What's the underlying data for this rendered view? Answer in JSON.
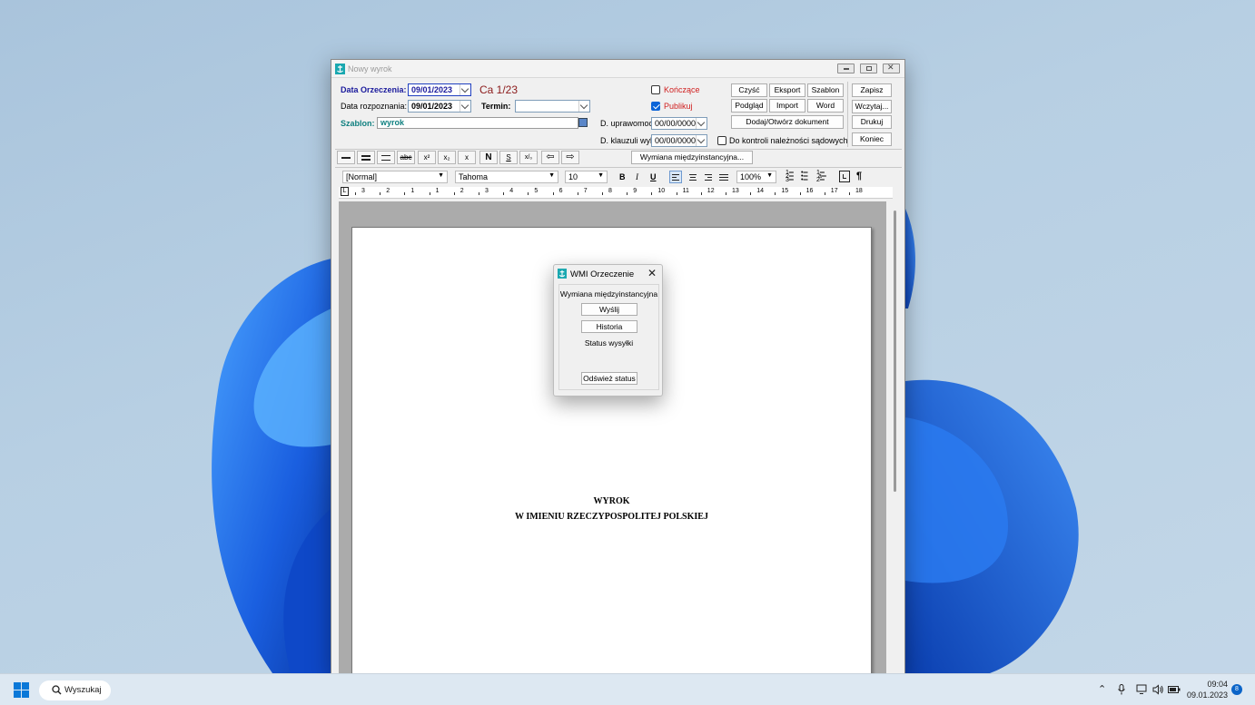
{
  "window": {
    "title": "Nowy wyrok"
  },
  "form": {
    "data_orzeczenia_label": "Data Orzeczenia:",
    "data_orzeczenia_value": "09/01/2023",
    "case_number": "Ca 1/23",
    "data_rozpoznania_label": "Data rozpoznania:",
    "data_rozpoznania_value": "09/01/2023",
    "termin_label": "Termin:",
    "termin_value": "",
    "szablon_label": "Szablon:",
    "szablon_value": "wyrok",
    "konczace_label": "Kończące",
    "konczace_checked": false,
    "publikuj_label": "Publikuj",
    "publikuj_checked": true,
    "d_uprawomoc_label": "D. uprawomoc.:",
    "d_uprawomoc_value": "00/00/0000",
    "d_klauzuli_label": "D. klauzuli wyk.:",
    "d_klauzuli_value": "00/00/0000",
    "kontrola_label": "Do kontroli należności sądowych",
    "kontrola_checked": false
  },
  "buttons": {
    "czysc": "Czyść",
    "eksport": "Eksport",
    "szablon": "Szablon",
    "podglad": "Podgląd",
    "import": "Import",
    "word": "Word",
    "dodaj": "Dodaj/Otwórz dokument",
    "zapisz": "Zapisz",
    "wczytaj": "Wczytaj...",
    "drukuj": "Drukuj",
    "koniec": "Koniec",
    "wymiana": "Wymiana międzyinstancyjna..."
  },
  "toolbar_icons": [
    "line-single-icon",
    "line-double-icon",
    "line-wide-icon",
    "strikethrough-icon",
    "superscript-icon",
    "subscript-icon",
    "clear-format-icon",
    "n-bold-icon",
    "s-icon",
    "percent-icon",
    "indent-decrease-icon",
    "indent-increase-icon"
  ],
  "toolbar_labels": {
    "abc": "abc",
    "sup": "x²",
    "sub": "x₂",
    "x": "x",
    "n": "N",
    "s": "S",
    "pct": "x/₀"
  },
  "format_bar": {
    "style": "[Normal]",
    "font": "Tahoma",
    "size": "10",
    "bold": "B",
    "italic": "I",
    "underline": "U",
    "zoom": "100%",
    "pilcrow": "¶"
  },
  "ruler_numbers": [
    "3",
    "2",
    "1",
    "1",
    "2",
    "3",
    "4",
    "5",
    "6",
    "7",
    "8",
    "9",
    "10",
    "11",
    "12",
    "13",
    "14",
    "15",
    "16",
    "17",
    "18"
  ],
  "document": {
    "heading1": "WYROK",
    "heading2": "W IMIENIU RZECZYPOSPOLITEJ POLSKIEJ"
  },
  "dialog": {
    "title": "WMI Orzeczenie",
    "section_label": "Wymiana międzyinstancyjna",
    "wyslij": "Wyślij",
    "historia": "Historia",
    "status_label": "Status wysyłki",
    "odswiez": "Odśwież status"
  },
  "taskbar": {
    "search_label": "Wyszukaj",
    "time": "09:04",
    "date": "09.01.2023",
    "notification_count": "8"
  },
  "colors": {
    "label_blue": "#1a1a9c",
    "case_red": "#8b1a1a",
    "teal": "#108080",
    "konczace_red": "#d02020",
    "accent": "#0a64d8"
  }
}
